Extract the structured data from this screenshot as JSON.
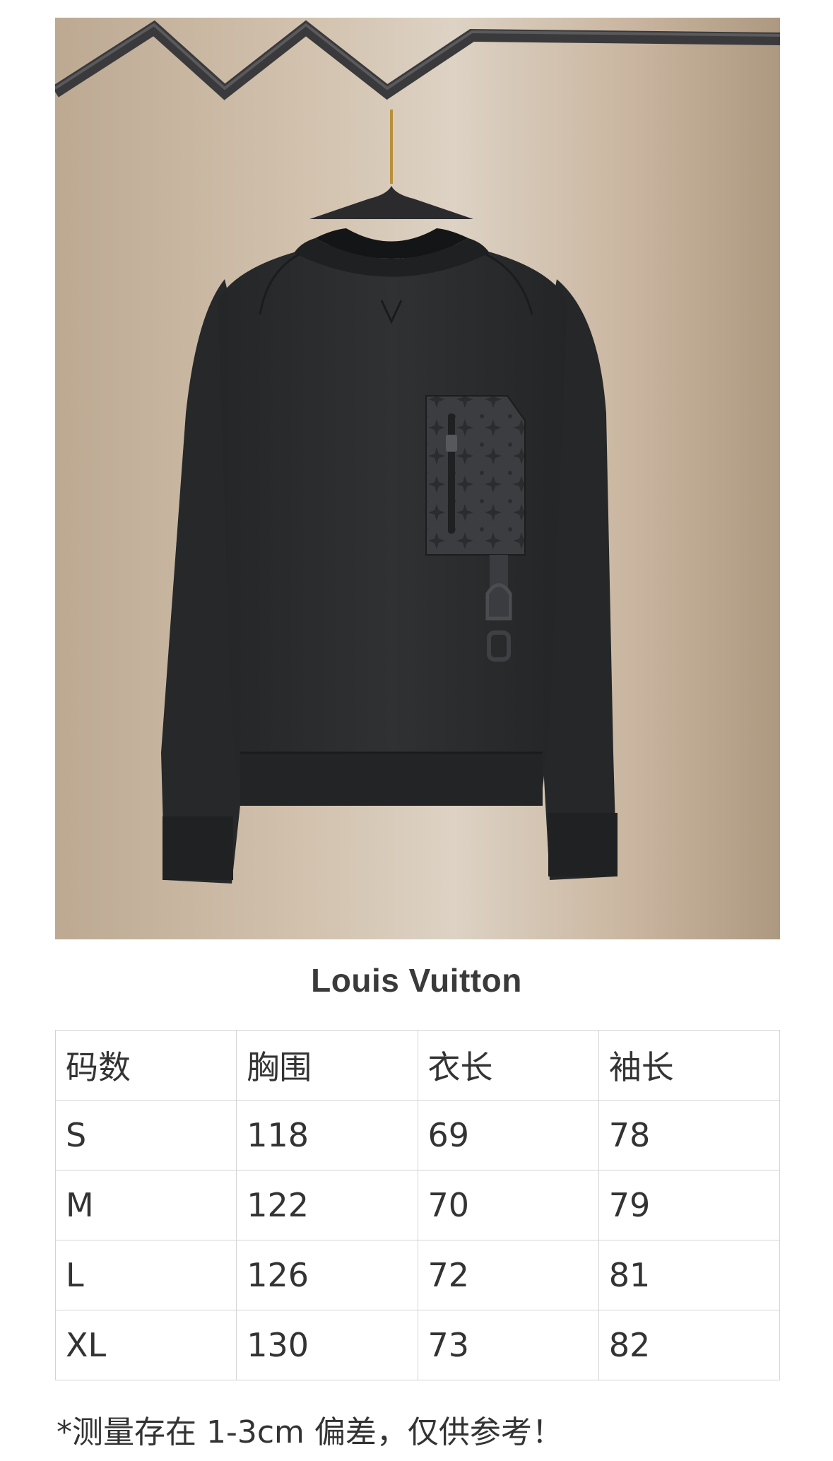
{
  "brand": "Louis Vuitton",
  "table": {
    "headers": [
      "码数",
      "胸围",
      "衣长",
      "袖长"
    ],
    "rows": [
      [
        "S",
        "118",
        "69",
        "78"
      ],
      [
        "M",
        "122",
        "70",
        "79"
      ],
      [
        "L",
        "126",
        "72",
        "81"
      ],
      [
        "XL",
        "130",
        "73",
        "82"
      ]
    ]
  },
  "note": "*测量存在 1-3cm 偏差，仅供参考！",
  "colors": {
    "background": "#ffffff",
    "photo_wall": "#d2c2ae",
    "garment": "#2b2d2e",
    "text": "#333333",
    "table_border": "#d4d4d4"
  },
  "icons": [
    "hanger",
    "sweatshirt",
    "monogram-pocket",
    "zipper-pull",
    "d-ring-tab"
  ]
}
